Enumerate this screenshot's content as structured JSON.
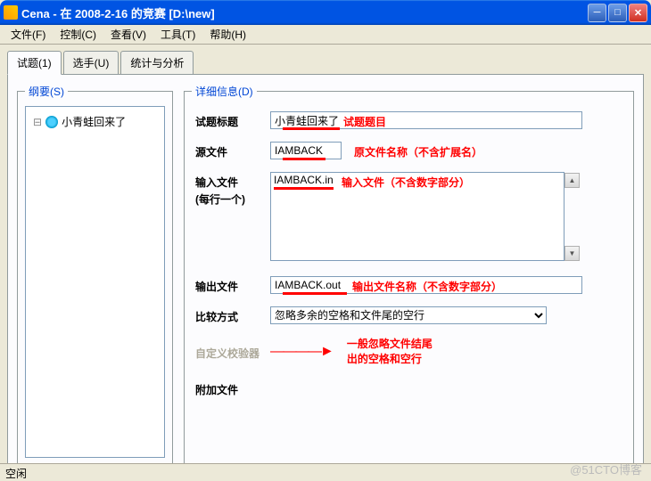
{
  "window": {
    "title": "Cena - 在 2008-2-16 的竞赛 [D:\\new]"
  },
  "menu": {
    "file": "文件(F)",
    "control": "控制(C)",
    "view": "查看(V)",
    "tools": "工具(T)",
    "help": "帮助(H)"
  },
  "tabs": {
    "t1": "试题(1)",
    "t2": "选手(U)",
    "t3": "统计与分析"
  },
  "outline": {
    "legend": "纲要(S)",
    "node1": "小青蛙回来了"
  },
  "details": {
    "legend": "详细信息(D)",
    "labels": {
      "title": "试题标题",
      "source": "源文件",
      "input": "输入文件",
      "input2": "(每行一个)",
      "output": "输出文件",
      "compare": "比较方式",
      "custom": "自定义校验器",
      "attach": "附加文件"
    },
    "values": {
      "title": "小青蛙回来了",
      "source": "IAMBACK",
      "input": "IAMBACK.in",
      "output": "IAMBACK.out",
      "compare": "忽略多余的空格和文件尾的空行"
    }
  },
  "annotations": {
    "a1": "试题题目",
    "a2": "原文件名称（不含扩展名）",
    "a3": "输入文件（不含数字部分）",
    "a4": "输出文件名称（不含数字部分）",
    "a5a": "一般忽略文件结尾",
    "a5b": "出的空格和空行"
  },
  "status": {
    "idle": "空闲"
  },
  "watermark": "@51CTO博客"
}
